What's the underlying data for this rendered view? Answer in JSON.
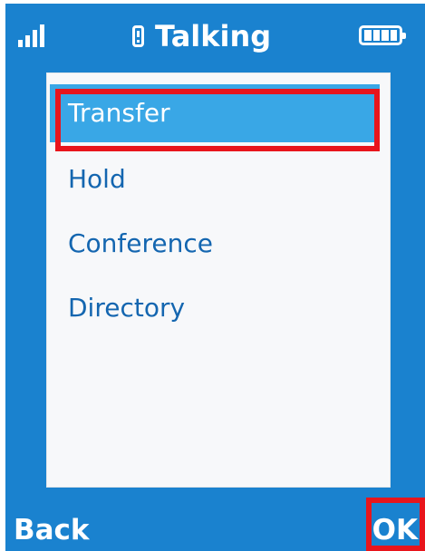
{
  "status_bar": {
    "signal_icon": "signal-bars-icon",
    "call_icon": "phone-handset-icon",
    "title": "Talking",
    "battery_icon": "battery-icon"
  },
  "menu": {
    "items": [
      {
        "label": "Transfer",
        "selected": true
      },
      {
        "label": "Hold",
        "selected": false
      },
      {
        "label": "Conference",
        "selected": false
      },
      {
        "label": "Directory",
        "selected": false
      }
    ]
  },
  "softkeys": {
    "left": "Back",
    "right": "OK"
  },
  "colors": {
    "background": "#1a82cf",
    "selection": "#39a7e6",
    "menu_text": "#1466b0",
    "highlight_frame": "#e8151c"
  }
}
